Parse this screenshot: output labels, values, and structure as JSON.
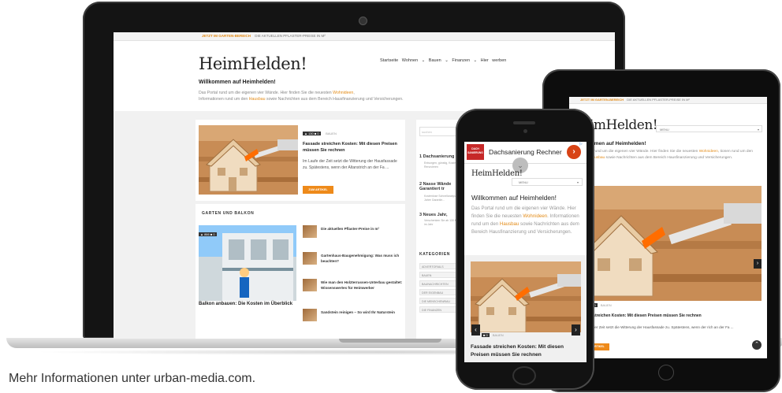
{
  "footer": {
    "text": "Mehr Informationen unter urban-media.com."
  },
  "laptop": {
    "topbar": {
      "tag": "JETZT IM GARTEN-BEREICH",
      "text": "DIE AKTUELLEN PFLASTER-PREISE IN M²"
    },
    "logo": "HeimHelden!",
    "nav": "Startseite   Wohnen ⌄   Bauen ⌄   Finanzen ⌄   Hier werben",
    "welcome": "Willkommen auf Heimhelden!",
    "desc_1": "Das Portal rund um die eigenen vier Wände. Hier finden Sie die neuesten",
    "desc_hl1": "Wohnideen",
    "desc_2": ",",
    "desc_3": "Informationen rund um den",
    "desc_hl2": "Hausbau",
    "desc_4": "sowie Nachrichten aus dem Bereich Hausfinanzierung und Versicherungen.",
    "featured": {
      "meta": "▲ 130  ■ 0",
      "category": "BAUEN",
      "title": "Fassade streichen Kosten: Mit diesen Preisen müssen Sie rechnen",
      "text": "Im Laufe der Zeit setzt die Witterung der Hausfassade zu. Spätestens, wenn der Altanstrich an der Fa ...",
      "button": "ZUM ARTIKEL"
    },
    "garten": {
      "heading": "GARTEN UND BALKON",
      "meta": "▲ 866  ■ 0",
      "caption": "Balkon anbauen: Die Kosten im Überblick",
      "items": [
        "Die aktuellen Pflaster-Preise in m²",
        "Gartenhaus-Baugenehmigung: Was muss ich beachten?",
        "Wie man den Holzterrassen-Unterbau gestaltet: Wissenswertes für Heimwerker",
        "Sandstein reinigen – So wird Ihr Naturstein"
      ]
    },
    "sidebar": {
      "search_placeholder": "suchen",
      "items": [
        {
          "num": "1",
          "title": "Dachsanierung",
          "sub": "Entsorgen, günstig, Kosten ... Renovieren"
        },
        {
          "num": "2",
          "title": "Nasse Wände Garantiert tr",
          "sub": "Kostenlose Schnellanalyse 5 Jahre Garantie..."
        },
        {
          "num": "3",
          "title": "Neues Jahr, ",
          "sub": "Verschenken Sie ab 130 €, im Jahr"
        }
      ],
      "kategorien_heading": "KATEGORIEN",
      "kategorien": [
        "ADVERTORIALS",
        "BAUEN",
        "BAUNACHRICHTEN",
        "DER EIGENBAU",
        "DIE MENSCHEN/BAU",
        "DIE FINANZEN"
      ]
    }
  },
  "tablet": {
    "topbar": {
      "tag": "JETZT IM GARTEN-BEREICH",
      "text": "DIE AKTUELLEN PFLASTER-PREISE IN M²"
    },
    "logo": "imHelden!",
    "menu": "MENU",
    "welcome": "mmen auf Heimhelden!",
    "desc_1": "al rund um die eigenen vier Wände. Hier finden Sie die neuesten",
    "desc_hl1": "Wohnideen",
    "desc_2": ",",
    "desc_3": "tionen rund um den",
    "desc_hl2": "Hausbau",
    "desc_4": "sowie Nachrichten aus dem Bereich Hausfinanzierung und Versicherungen.",
    "meta": "■ 0",
    "category": "BAUEN",
    "title": "e streichen Kosten: Mit diesen Preisen müssen Sie rechnen",
    "text": "e der Zeit setzt die Witterung der Hausfassade zu. Spätestens, wenn der rich an der Fa ...",
    "button": "RTIKEL"
  },
  "phone": {
    "ad": {
      "logo": "DACH SANIERUNG",
      "text": "Dachsanierung Rechner",
      "go": "›"
    },
    "logo": "HeimHelden!",
    "menu": "MENU",
    "welcome": "Willkommen auf Heimhelden!",
    "desc_1": "Das Portal rund um die eigenen vier Wände. Hier finden Sie die neuesten",
    "desc_hl1": "Wohnideen",
    "desc_2": ". Informationen rund um den",
    "desc_hl2": "Hausbau",
    "desc_3": "sowie Nachrichten aus dem Bereich Hausfinanzierung und Versicherungen.",
    "meta": "■ 0",
    "category": "BAUEN",
    "title": "Fassade streichen Kosten: Mit diesen Preisen müssen Sie rechnen"
  }
}
